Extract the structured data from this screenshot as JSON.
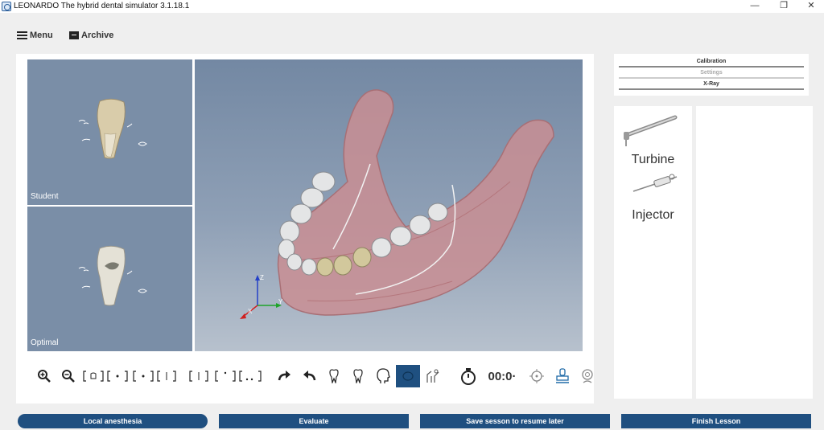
{
  "window": {
    "title": "LEONARDO The hybrid dental simulator 3.1.18.1",
    "controls": {
      "minimize": "—",
      "restore": "❐",
      "close": "✕"
    }
  },
  "menu": {
    "menu_label": "Menu",
    "archive_label": "Archive"
  },
  "views": {
    "student_label": "Student",
    "optimal_label": "Optimal"
  },
  "axes": {
    "z": "Z",
    "y": "Y",
    "x": "X"
  },
  "toolbar": {
    "timer": "00:0·",
    "icons": [
      "zoom-in-icon",
      "zoom-out-icon",
      "view-front-icon",
      "view-buccal-icon",
      "view-lingual-icon",
      "view-occlusal-icon",
      "view-split-icon",
      "view-grid-icon",
      "redo-icon",
      "undo-icon",
      "tooth-icon",
      "tooth-outline-icon",
      "head-icon",
      "eye-icon",
      "tool-holder-icon",
      "stopwatch-icon",
      "target-icon",
      "stamp-icon",
      "webcam-icon"
    ]
  },
  "calibration": {
    "calibration": "Calibration",
    "settings": "Settings",
    "xray": "X-Ray"
  },
  "instruments": {
    "turbine": "Turbine",
    "injector": "Injector"
  },
  "bottom": {
    "local_anesthesia": "Local anesthesia",
    "evaluate": "Evaluate",
    "save": "Save sesson to resume later",
    "finish": "Finish Lesson"
  },
  "colors": {
    "accent": "#1f4f80",
    "viewport": "#7a8ea7",
    "jaw": "#c98e93",
    "tooth": "#ece8df"
  }
}
